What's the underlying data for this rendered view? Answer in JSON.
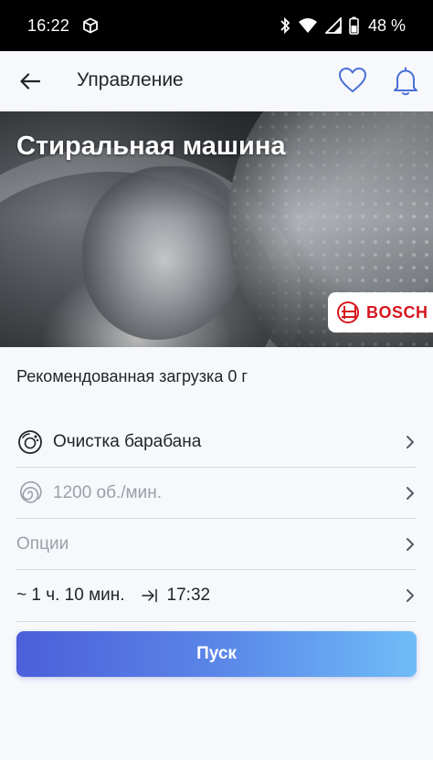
{
  "status_bar": {
    "time": "16:22",
    "battery": "48 %"
  },
  "app_bar": {
    "title": "Управление"
  },
  "hero": {
    "title": "Стиральная машина",
    "brand": "BOSCH"
  },
  "recommended_load": "Рекомендованная загрузка 0 г",
  "settings": {
    "program": "Очистка барабана",
    "spin": "1200 об./мин.",
    "options": "Опции",
    "duration": "~ 1 ч. 10 мин.",
    "end_time": "17:32"
  },
  "start_button": "Пуск",
  "colors": {
    "accent_start": "#4b5fd9",
    "accent_end": "#6fbcf7",
    "icon_blue": "#4a6fd8",
    "brand_red": "#d7171f"
  }
}
